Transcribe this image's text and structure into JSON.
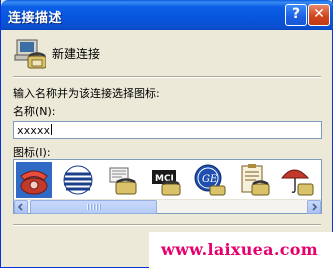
{
  "window": {
    "title": "连接描述",
    "help_label": "?",
    "close_label": "✕"
  },
  "connection": {
    "icon": "phone-computer-icon",
    "name": "新建连接"
  },
  "form": {
    "prompt": "输入名称并为该连接选择图标:",
    "name_label": "名称(N):",
    "name_value": "xxxxx",
    "icon_label": "图标(I):"
  },
  "icon_list": {
    "icons": [
      "red-telephone-icon",
      "globe-at&t-icon",
      "fax-phone-icon",
      "mci-logo-icon",
      "ge-logo-icon",
      "clipboard-phone-icon",
      "umbrella-phone-icon"
    ],
    "selected_index": 0
  },
  "colors": {
    "title_bar": "#0a5ddf",
    "selection": "#316ac5",
    "watermark": "#e6006e"
  },
  "watermark": {
    "text": "www.laixuea.com"
  }
}
